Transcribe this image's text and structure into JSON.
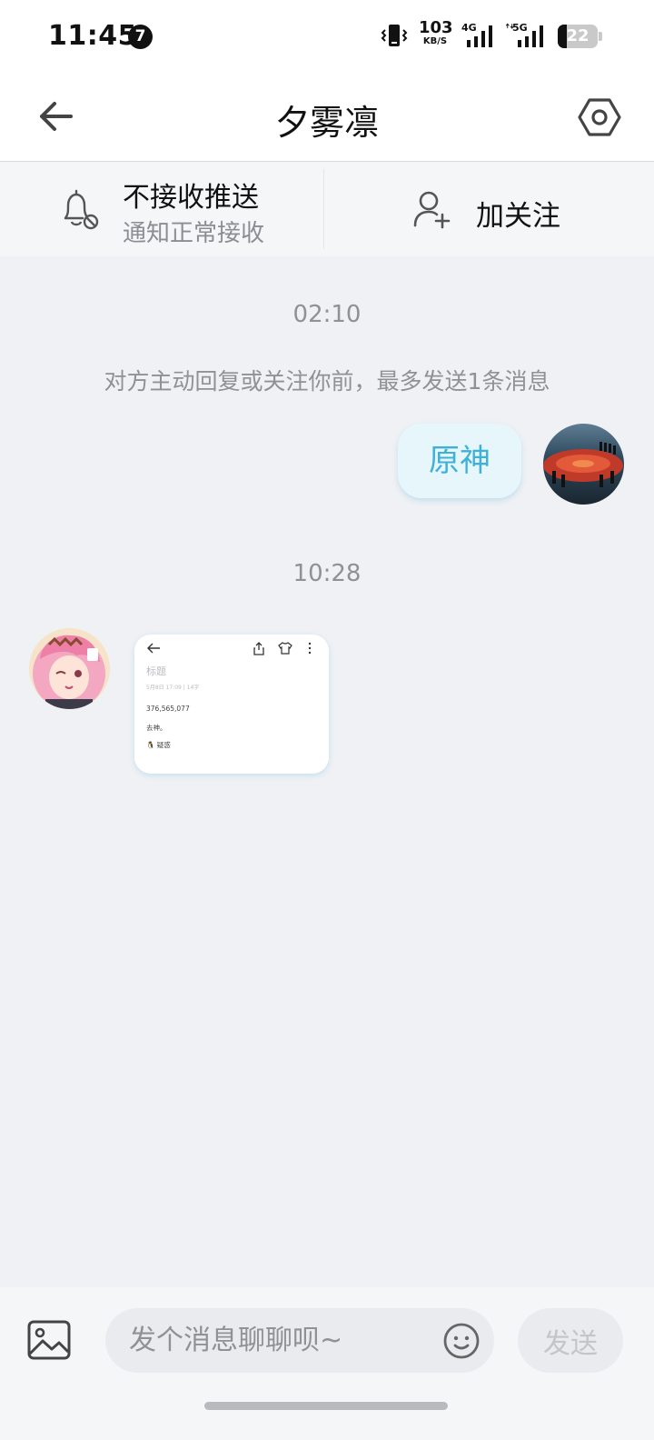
{
  "status_bar": {
    "time": "11:45",
    "notification_count": "7",
    "net_speed_value": "103",
    "net_speed_unit": "KB/S",
    "signal_1_label": "4G",
    "signal_2_label": "5G",
    "battery_level": "22"
  },
  "header": {
    "title": "夕雾凛",
    "back_icon": "arrow-left-icon",
    "settings_icon": "hexagon-gear-icon"
  },
  "options": {
    "push_title": "不接收推送",
    "push_subtitle": "通知正常接收",
    "follow_label": "加关注"
  },
  "chat": {
    "messages": [
      {
        "type": "time",
        "text": "02:10"
      },
      {
        "type": "system",
        "text": "对方主动回复或关注你前，最多发送1条消息"
      },
      {
        "type": "outgoing_text",
        "text": "原神"
      },
      {
        "type": "time",
        "text": "10:28"
      },
      {
        "type": "incoming_image",
        "card": {
          "title": "标题",
          "meta": "5月8日 17:09  |  14字",
          "line1": "376,565,077",
          "line2": "去神。",
          "line3": "🐧 疑惑"
        }
      }
    ]
  },
  "composer": {
    "placeholder": "发个消息聊聊呗~",
    "send_label": "发送"
  },
  "colors": {
    "background": "#eff1f4",
    "bubble_out": "#e6f6fb",
    "bubble_out_text": "#3fb1d8",
    "muted_text": "#8e9196"
  }
}
